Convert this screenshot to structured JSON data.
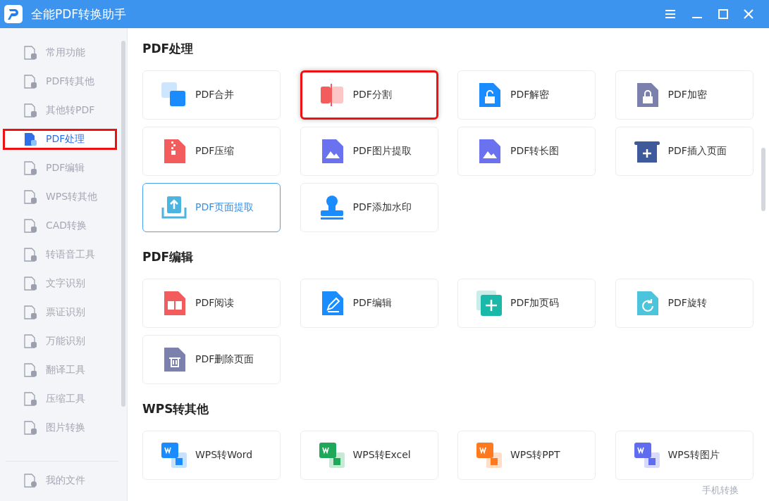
{
  "window": {
    "title": "全能PDF转换助手"
  },
  "sidebar": {
    "items": [
      {
        "label": "常用功能",
        "selected": false,
        "highlighted": false
      },
      {
        "label": "PDF转其他",
        "selected": false,
        "highlighted": false
      },
      {
        "label": "其他转PDF",
        "selected": false,
        "highlighted": false
      },
      {
        "label": "PDF处理",
        "selected": true,
        "highlighted": true
      },
      {
        "label": "PDF编辑",
        "selected": false,
        "highlighted": false
      },
      {
        "label": "WPS转其他",
        "selected": false,
        "highlighted": false
      },
      {
        "label": "CAD转换",
        "selected": false,
        "highlighted": false
      },
      {
        "label": "转语音工具",
        "selected": false,
        "highlighted": false
      },
      {
        "label": "文字识别",
        "selected": false,
        "highlighted": false
      },
      {
        "label": "票证识别",
        "selected": false,
        "highlighted": false
      },
      {
        "label": "万能识别",
        "selected": false,
        "highlighted": false
      },
      {
        "label": "翻译工具",
        "selected": false,
        "highlighted": false
      },
      {
        "label": "压缩工具",
        "selected": false,
        "highlighted": false
      },
      {
        "label": "图片转换",
        "selected": false,
        "highlighted": false
      }
    ],
    "footer_item": {
      "label": "我的文件"
    }
  },
  "sections": [
    {
      "title": "PDF处理",
      "tools": [
        {
          "label": "PDF合并",
          "kind": "pair",
          "color": "#1a8cff",
          "selected": false,
          "highlighted": false
        },
        {
          "label": "PDF分割",
          "kind": "split",
          "color": "#f25c5c",
          "selected": false,
          "highlighted": true
        },
        {
          "label": "PDF解密",
          "kind": "unlock",
          "color": "#1a8cff",
          "selected": false,
          "highlighted": false
        },
        {
          "label": "PDF加密",
          "kind": "lock",
          "color": "#7b80ad",
          "selected": false,
          "highlighted": false
        },
        {
          "label": "PDF压缩",
          "kind": "zip",
          "color": "#f25c5c",
          "selected": false,
          "highlighted": false
        },
        {
          "label": "PDF图片提取",
          "kind": "image",
          "color": "#6a72f0",
          "selected": false,
          "highlighted": false
        },
        {
          "label": "PDF转长图",
          "kind": "image",
          "color": "#6a72f0",
          "selected": false,
          "highlighted": false
        },
        {
          "label": "PDF插入页面",
          "kind": "insert",
          "color": "#3f5a9a",
          "selected": false,
          "highlighted": false
        },
        {
          "label": "PDF页面提取",
          "kind": "extract",
          "color": "#4bb4e0",
          "selected": true,
          "highlighted": false
        },
        {
          "label": "PDF添加水印",
          "kind": "stamp",
          "color": "#1a8cff",
          "selected": false,
          "highlighted": false
        }
      ]
    },
    {
      "title": "PDF编辑",
      "tools": [
        {
          "label": "PDF阅读",
          "kind": "read",
          "color": "#f25c5c",
          "selected": false,
          "highlighted": false
        },
        {
          "label": "PDF编辑",
          "kind": "edit",
          "color": "#1a8cff",
          "selected": false,
          "highlighted": false
        },
        {
          "label": "PDF加页码",
          "kind": "plus",
          "color": "#1ab8a8",
          "selected": false,
          "highlighted": false
        },
        {
          "label": "PDF旋转",
          "kind": "rotate",
          "color": "#4bc4dc",
          "selected": false,
          "highlighted": false
        },
        {
          "label": "PDF删除页面",
          "kind": "delete",
          "color": "#7b80ad",
          "selected": false,
          "highlighted": false
        }
      ]
    },
    {
      "title": "WPS转其他",
      "tools": [
        {
          "label": "WPS转Word",
          "kind": "wps",
          "color": "#1a8cff",
          "selected": false,
          "highlighted": false
        },
        {
          "label": "WPS转Excel",
          "kind": "wps",
          "color": "#1fa85a",
          "selected": false,
          "highlighted": false
        },
        {
          "label": "WPS转PPT",
          "kind": "wps",
          "color": "#ff7a1f",
          "selected": false,
          "highlighted": false
        },
        {
          "label": "WPS转图片",
          "kind": "wps",
          "color": "#5f6cf0",
          "selected": false,
          "highlighted": false
        }
      ]
    }
  ],
  "floating_link": "手机转换"
}
